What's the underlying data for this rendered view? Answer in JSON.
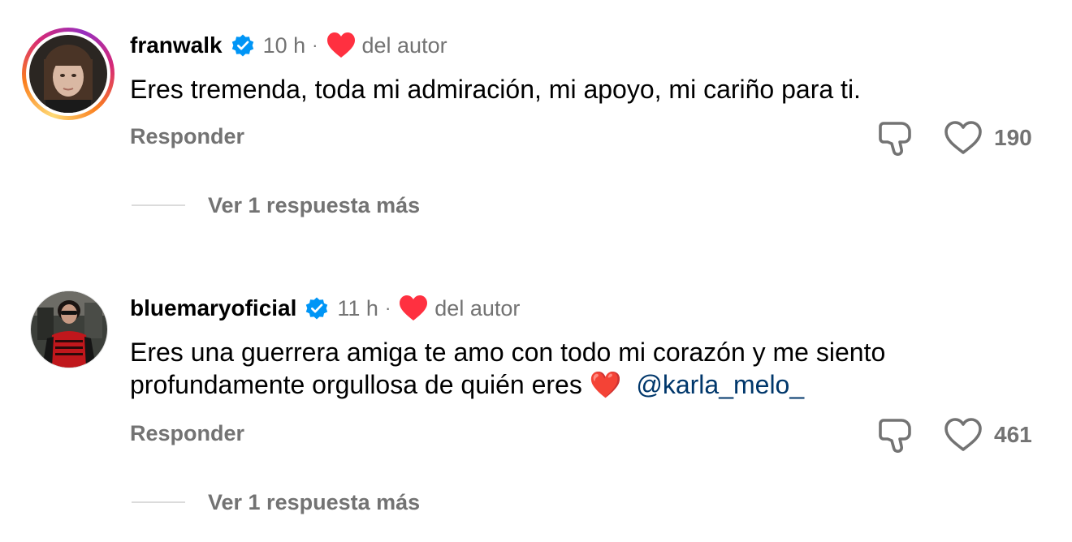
{
  "comments": [
    {
      "username": "franwalk",
      "verified": true,
      "time": "10 h",
      "separator": "·",
      "author_like_label": "del autor",
      "text_before": "Eres tremenda, toda mi admiración, mi apoyo, mi cariño para ti.",
      "emoji": "",
      "mention": "",
      "reply_label": "Responder",
      "like_count": "190",
      "more_replies_label": "Ver 1 respuesta más",
      "has_story_ring": true
    },
    {
      "username": "bluemaryoficial",
      "verified": true,
      "time": "11 h",
      "separator": "·",
      "author_like_label": "del autor",
      "text_before": "Eres una guerrera amiga te amo con todo mi corazón y me siento profundamente orgullosa de quién eres ",
      "emoji": "❤️",
      "mention": "@karla_melo_",
      "reply_label": "Responder",
      "like_count": "461",
      "more_replies_label": "Ver 1 respuesta más",
      "has_story_ring": false
    }
  ],
  "colors": {
    "verified_blue": "#0095f6",
    "heart_red": "#ff3040",
    "secondary_text": "#737373",
    "mention_blue": "#00376b"
  },
  "icons": {
    "verified": "verified-badge-icon",
    "author_heart": "heart-filled-icon",
    "dislike": "thumbs-down-icon",
    "like": "heart-outline-icon"
  }
}
